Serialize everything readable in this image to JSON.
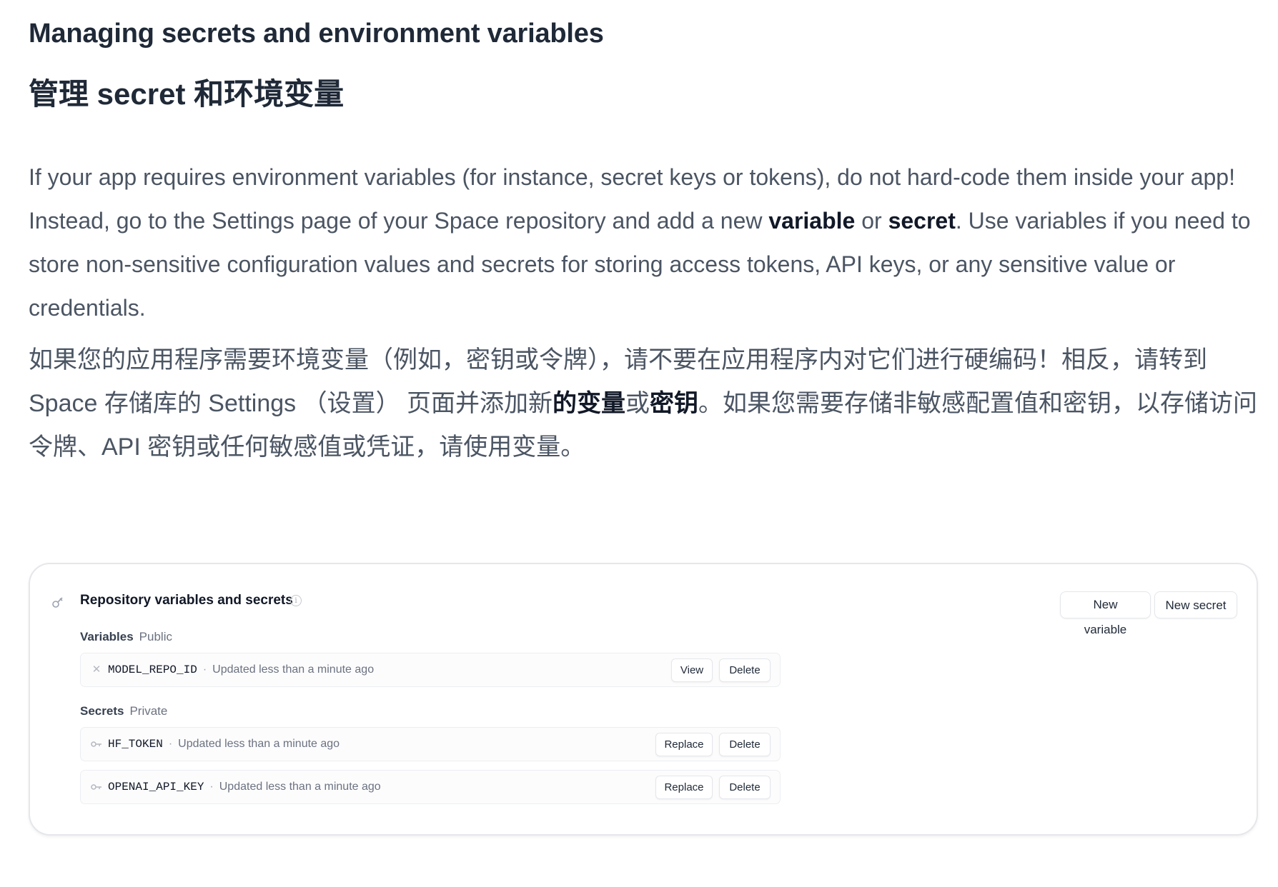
{
  "heading_en": "Managing secrets and environment variables",
  "heading_zh": "管理 secret 和环境变量",
  "para_en": {
    "part1": "If your app requires environment variables (for instance, secret keys or tokens), do not hard-code them inside your app! Instead, go to the Settings page of your Space repository and add a new ",
    "bold1": "variable",
    "part2": " or ",
    "bold2": "secret",
    "part3": ". Use variables if you need to store non-sensitive configuration values and secrets for storing access tokens, API keys, or any sensitive value or credentials."
  },
  "para_zh": {
    "part1": "如果您的应用程序需要环境变量（例如，密钥或令牌），请不要在应用程序内对它们进行硬编码！相反，请转到 Space 存储库的 Settings （设置） 页面并添加新",
    "bold1": "的变量",
    "part2": "或",
    "bold2": "密钥",
    "part3": "。如果您需要存储非敏感配置值和密钥，以存储访问令牌、API 密钥或任何敏感值或凭证，请使用变量。"
  },
  "panel": {
    "title": "Repository variables and secrets",
    "info_icon": "info-icon",
    "new_variable_label": "New variable",
    "new_secret_label": "New secret",
    "variables_label": "Variables",
    "variables_sub": "Public",
    "secrets_label": "Secrets",
    "secrets_sub": "Private",
    "variables": [
      {
        "name": "MODEL_REPO_ID",
        "updated": "Updated less than a minute ago",
        "action1": "View",
        "action2": "Delete"
      }
    ],
    "secrets": [
      {
        "name": "HF_TOKEN",
        "updated": "Updated less than a minute ago",
        "action1": "Replace",
        "action2": "Delete"
      },
      {
        "name": "OPENAI_API_KEY",
        "updated": "Updated less than a minute ago",
        "action1": "Replace",
        "action2": "Delete"
      }
    ],
    "separator": "·"
  }
}
